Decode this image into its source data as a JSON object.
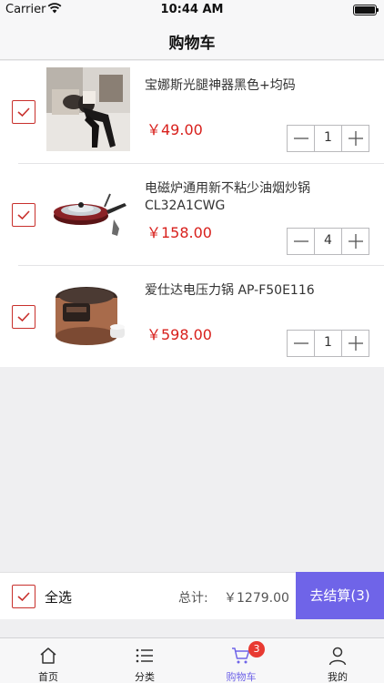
{
  "status_bar": {
    "carrier": "Carrier",
    "time": "10:44 AM"
  },
  "nav": {
    "title": "购物车"
  },
  "cart": {
    "items": [
      {
        "name": "宝娜斯光腿神器黑色+均码",
        "price": "￥49.00",
        "quantity": "1",
        "checked": true,
        "image_icon": "product-tights-photo"
      },
      {
        "name": "电磁炉通用新不粘少油烟炒锅CL32A1CWG",
        "price": "￥158.00",
        "quantity": "4",
        "checked": true,
        "image_icon": "product-wok-photo"
      },
      {
        "name": "爱仕达电压力锅 AP-F50E116",
        "price": "￥598.00",
        "quantity": "1",
        "checked": true,
        "image_icon": "product-pressure-cooker-photo"
      }
    ]
  },
  "footer": {
    "select_all_label": "全选",
    "select_all_checked": true,
    "total_label": "总计:",
    "total_value": "￥1279.00",
    "checkout_label": "去结算(3)"
  },
  "tabs": [
    {
      "label": "首页",
      "icon": "home-icon"
    },
    {
      "label": "分类",
      "icon": "list-icon"
    },
    {
      "label": "购物车",
      "icon": "cart-icon",
      "badge": "3",
      "active": true
    },
    {
      "label": "我的",
      "icon": "profile-icon"
    }
  ],
  "colors": {
    "accent": "#6f64e8",
    "price": "#d8201c",
    "checkbox": "#c8302c",
    "badge": "#e83a32"
  }
}
